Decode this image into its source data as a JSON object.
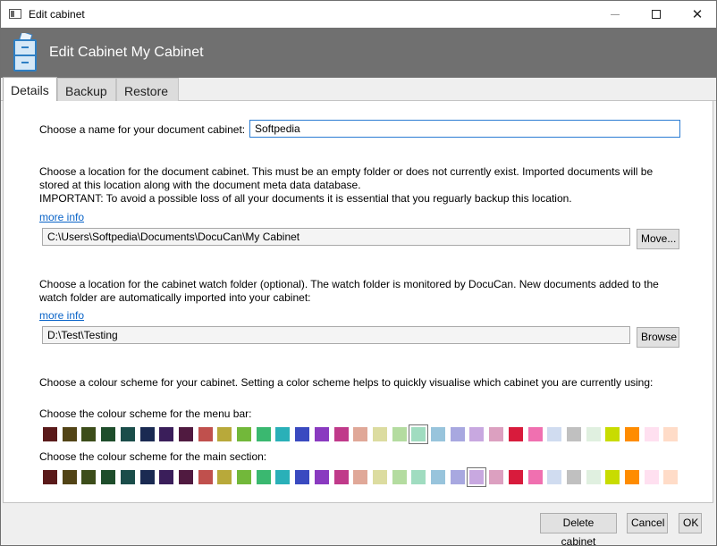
{
  "window": {
    "title": "Edit cabinet",
    "minimize_icon": "minimize-icon",
    "maximize_icon": "maximize-icon",
    "close_icon": "close-icon",
    "close_glyph": "✕"
  },
  "header": {
    "title": "Edit Cabinet My Cabinet",
    "icon": "filing-cabinet-icon"
  },
  "tabs": [
    {
      "label": "Details",
      "active": true
    },
    {
      "label": "Backup",
      "active": false
    },
    {
      "label": "Restore",
      "active": false
    }
  ],
  "details": {
    "name_label": "Choose a name for your document cabinet:",
    "name_value": "Softpedia",
    "location_text_1": "Choose a location for the document cabinet. This must be an empty folder or does not currently exist. Imported documents will be",
    "location_text_2": "stored at this location along with the document meta data database.",
    "location_text_3": "IMPORTANT: To avoid a possible loss of all your documents it is essential that you reguarly backup this location.",
    "location_more_info": "more info",
    "location_path": "C:\\Users\\Softpedia\\Documents\\DocuCan\\My Cabinet",
    "move_button": "Move...",
    "watch_text_1": "Choose a location for the cabinet watch folder (optional). The watch folder is monitored by DocuCan. New documents added to the",
    "watch_text_2": "watch folder are automatically imported into your cabinet:",
    "watch_more_info": "more info",
    "watch_path": "D:\\Test\\Testing",
    "browse_button": "Browse",
    "colour_intro": "Choose a colour scheme for your cabinet. Setting a color scheme helps to quickly visualise which cabinet you are currently using:",
    "menu_bar_label": "Choose the colour scheme for the menu bar:",
    "main_section_label": "Choose the colour scheme for the main section:",
    "palette_colors": [
      "#5a1a1a",
      "#524416",
      "#3c4d1a",
      "#1e4d2b",
      "#1a4d4a",
      "#1a2a52",
      "#3a1e5a",
      "#501a40",
      "#c0504d",
      "#b8a93a",
      "#72b83a",
      "#3ab870",
      "#2ab0b8",
      "#3a4ac0",
      "#8a3ac0",
      "#c03a8a",
      "#e0a898",
      "#dcdca0",
      "#b4dca0",
      "#a0dcc0",
      "#98c4dc",
      "#a8a8e0",
      "#c8a8e0",
      "#dca0c0",
      "#d81b3c",
      "#f070b0",
      "#d0dcf0",
      "#c0c0c0",
      "#e0f0e0",
      "#c8dc00",
      "#ff8c00",
      "#ffe0f0",
      "#ffdcc8"
    ],
    "menu_bar_selected_index": 19,
    "main_section_selected_index": 22
  },
  "footer": {
    "delete_button": "Delete cabinet",
    "cancel_button": "Cancel",
    "ok_button": "OK"
  }
}
